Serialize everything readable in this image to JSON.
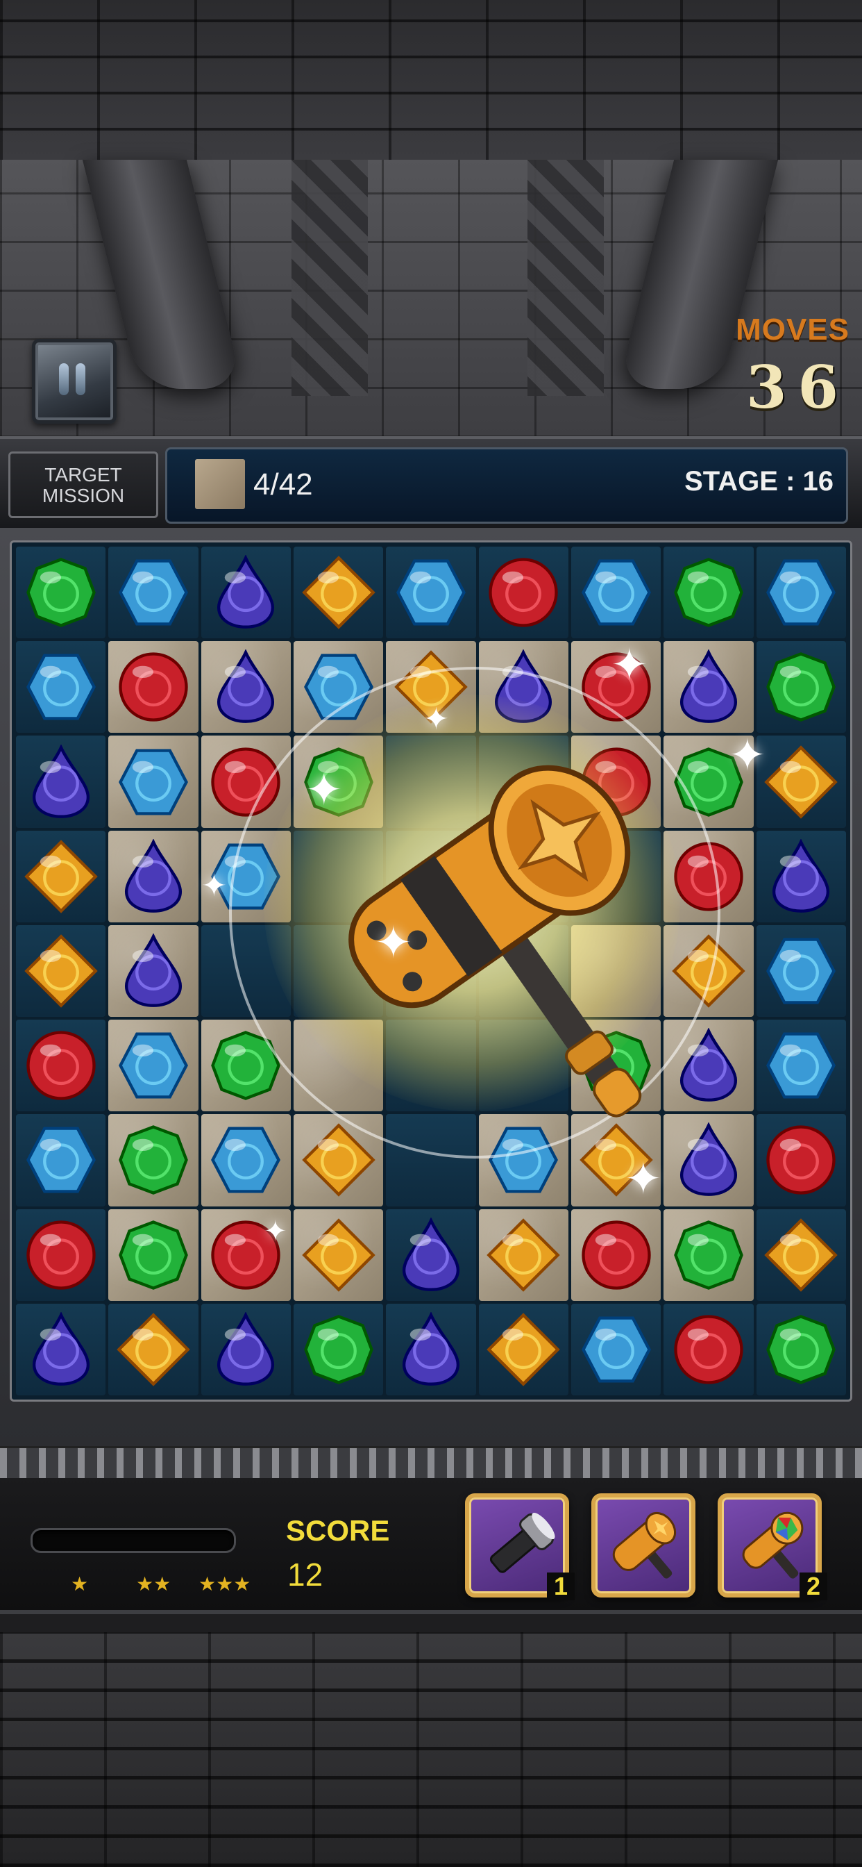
{
  "hud": {
    "moves_label": "MOVES",
    "moves_value": "36"
  },
  "mission": {
    "label_line1": "TARGET",
    "label_line2": "MISSION",
    "target_count": "4/42",
    "stage": "STAGE : 16"
  },
  "board": {
    "rows": [
      [
        "green",
        "blue",
        "purple",
        "yellow",
        "blue",
        "red",
        "blue",
        "green",
        "blue"
      ],
      [
        "blue",
        "red",
        "purple",
        "blue",
        "yellow",
        "purple",
        "red",
        "purple",
        "green"
      ],
      [
        "purple",
        "blue",
        "red",
        "green",
        "",
        "",
        "red",
        "green",
        "yellow"
      ],
      [
        "yellow",
        "purple",
        "blue",
        "",
        "",
        "",
        "",
        "red",
        "purple"
      ],
      [
        "yellow",
        "purple",
        "",
        "",
        "",
        "",
        "",
        "yellow",
        "blue"
      ],
      [
        "red",
        "blue",
        "green",
        "",
        "",
        "",
        "green",
        "purple",
        "blue"
      ],
      [
        "blue",
        "green",
        "blue",
        "yellow",
        "",
        "blue",
        "yellow",
        "purple",
        "red"
      ],
      [
        "red",
        "green",
        "red",
        "yellow",
        "purple",
        "yellow",
        "red",
        "green",
        "yellow"
      ],
      [
        "purple",
        "yellow",
        "purple",
        "green",
        "purple",
        "yellow",
        "blue",
        "red",
        "green"
      ]
    ],
    "stone_cells": [
      [
        1,
        1
      ],
      [
        1,
        2
      ],
      [
        1,
        3
      ],
      [
        1,
        4
      ],
      [
        1,
        5
      ],
      [
        1,
        6
      ],
      [
        1,
        7
      ],
      [
        2,
        1
      ],
      [
        2,
        2
      ],
      [
        2,
        3
      ],
      [
        2,
        6
      ],
      [
        2,
        7
      ],
      [
        3,
        1
      ],
      [
        3,
        2
      ],
      [
        3,
        7
      ],
      [
        4,
        1
      ],
      [
        4,
        6
      ],
      [
        4,
        7
      ],
      [
        5,
        1
      ],
      [
        5,
        2
      ],
      [
        5,
        3
      ],
      [
        5,
        6
      ],
      [
        5,
        7
      ],
      [
        6,
        1
      ],
      [
        6,
        2
      ],
      [
        6,
        3
      ],
      [
        6,
        5
      ],
      [
        6,
        6
      ],
      [
        6,
        7
      ],
      [
        7,
        1
      ],
      [
        7,
        2
      ],
      [
        7,
        3
      ],
      [
        7,
        5
      ],
      [
        7,
        6
      ],
      [
        7,
        7
      ]
    ]
  },
  "colors": {
    "green": "#22b23a",
    "blue": "#3a9ad6",
    "purple": "#4a3ab8",
    "yellow": "#e8a020",
    "red": "#c8202a"
  },
  "bottom": {
    "score_label": "SCORE",
    "score_value": "12",
    "progress_fraction": 0,
    "star_1": "★",
    "star_2": "★★",
    "star_3": "★★★",
    "boosters": [
      {
        "icon": "flashlight-icon",
        "count": "1"
      },
      {
        "icon": "hammer-icon",
        "count": ""
      },
      {
        "icon": "jewel-wand-icon",
        "count": "2"
      }
    ]
  }
}
